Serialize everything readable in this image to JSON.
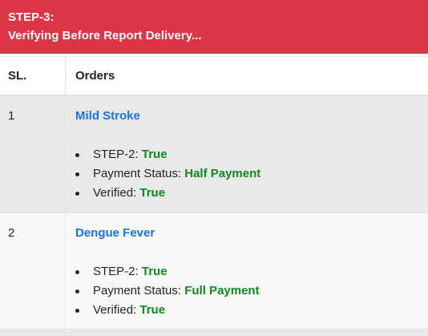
{
  "header": {
    "line1": "STEP-3:",
    "line2": "Verifying Before Report Delivery..."
  },
  "table": {
    "columns": [
      "SL.",
      "Orders"
    ],
    "rows": [
      {
        "sl": "1",
        "title": "Mild Stroke",
        "items": [
          {
            "label": "STEP-2: ",
            "value": "True"
          },
          {
            "label": "Payment Status: ",
            "value": "Half Payment"
          },
          {
            "label": "Verified: ",
            "value": "True"
          }
        ]
      },
      {
        "sl": "2",
        "title": "Dengue Fever",
        "items": [
          {
            "label": "STEP-2: ",
            "value": "True"
          },
          {
            "label": "Payment Status: ",
            "value": "Full Payment"
          },
          {
            "label": "Verified: ",
            "value": "True"
          }
        ]
      }
    ]
  },
  "colors": {
    "header_bg": "#dc3545",
    "link": "#1a73e8",
    "status_value": "#0a8a1f",
    "row_odd_bg": "#e9e9e9",
    "row_even_bg": "#f9f9f9"
  }
}
